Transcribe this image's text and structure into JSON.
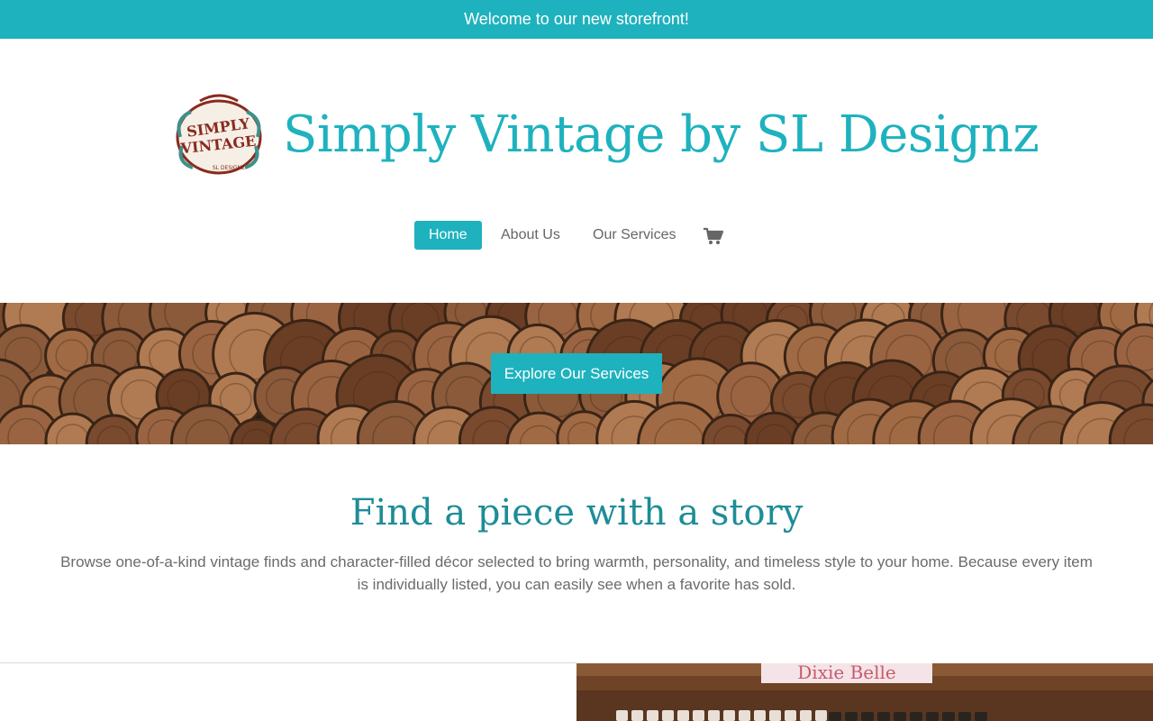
{
  "announcement": "Welcome to our new storefront!",
  "brand": {
    "title": "Simply Vintage by SL Designz",
    "logo_lines": [
      "SIMPLY",
      "VINTAGE",
      "SL DESIGNZ"
    ]
  },
  "nav": {
    "items": [
      {
        "label": "Home",
        "active": true
      },
      {
        "label": "About Us",
        "active": false
      },
      {
        "label": "Our Services",
        "active": false
      }
    ],
    "cart_icon": "cart-icon"
  },
  "hero": {
    "button_label": "Explore Our Services"
  },
  "story": {
    "title": "Find a piece with a story",
    "text": "Browse one-of-a-kind vintage finds and character-filled décor selected to bring warmth, personality, and timeless style to your home. Because every item is individually listed, you can easily see when a favorite has sold."
  },
  "next_section": {
    "heading_partial": "",
    "photo_sign": "Dixie Belle"
  },
  "colors": {
    "accent": "#1eb2be",
    "heading": "#1d8d97",
    "text": "#666666"
  }
}
